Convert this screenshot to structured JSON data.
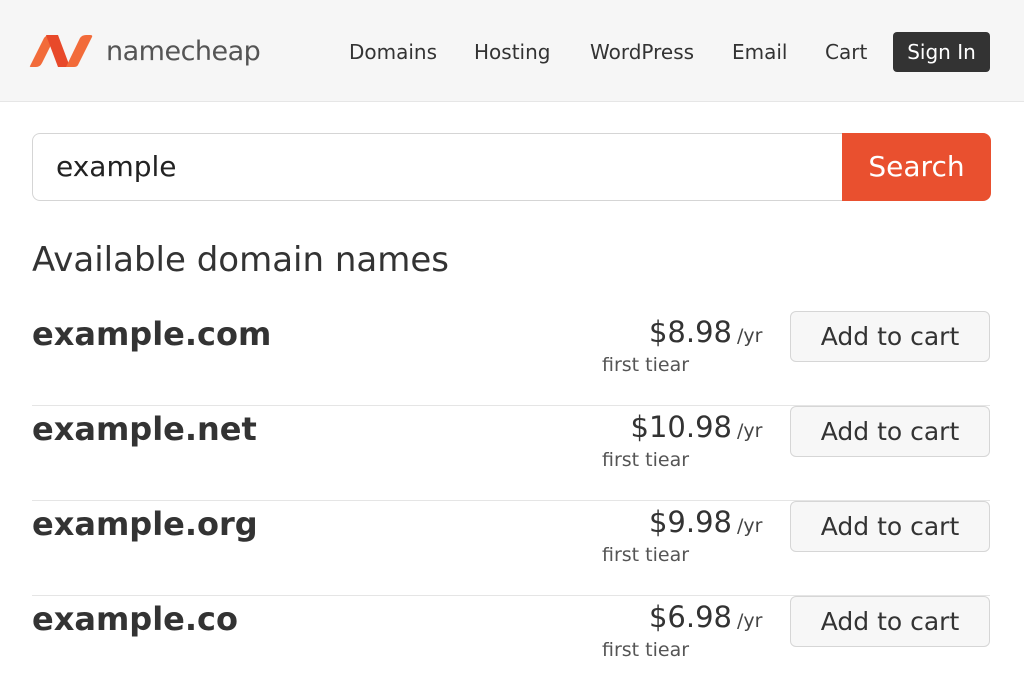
{
  "header": {
    "logo_text": "namecheap",
    "nav": [
      "Domains",
      "Hosting",
      "WordPress",
      "Email",
      "Cart"
    ],
    "signin_label": "Sign In"
  },
  "search": {
    "value": "example",
    "button_label": "Search"
  },
  "results": {
    "title": "Available domain names",
    "items": [
      {
        "domain": "example.com",
        "price": "$8.98",
        "per": "/yr",
        "note": "first tiear",
        "cart_label": "Add to cart"
      },
      {
        "domain": "example.net",
        "price": "$10.98",
        "per": "/yr",
        "note": "first tiear",
        "cart_label": "Add to cart"
      },
      {
        "domain": "example.org",
        "price": "$9.98",
        "per": "/yr",
        "note": "first tiear",
        "cart_label": "Add to cart"
      },
      {
        "domain": "example.co",
        "price": "$6.98",
        "per": "/yr",
        "note": "first tiear",
        "cart_label": "Add to cart"
      }
    ]
  },
  "colors": {
    "brand_orange": "#e9502f",
    "signin_bg": "#333333",
    "header_bg": "#f6f6f6"
  }
}
